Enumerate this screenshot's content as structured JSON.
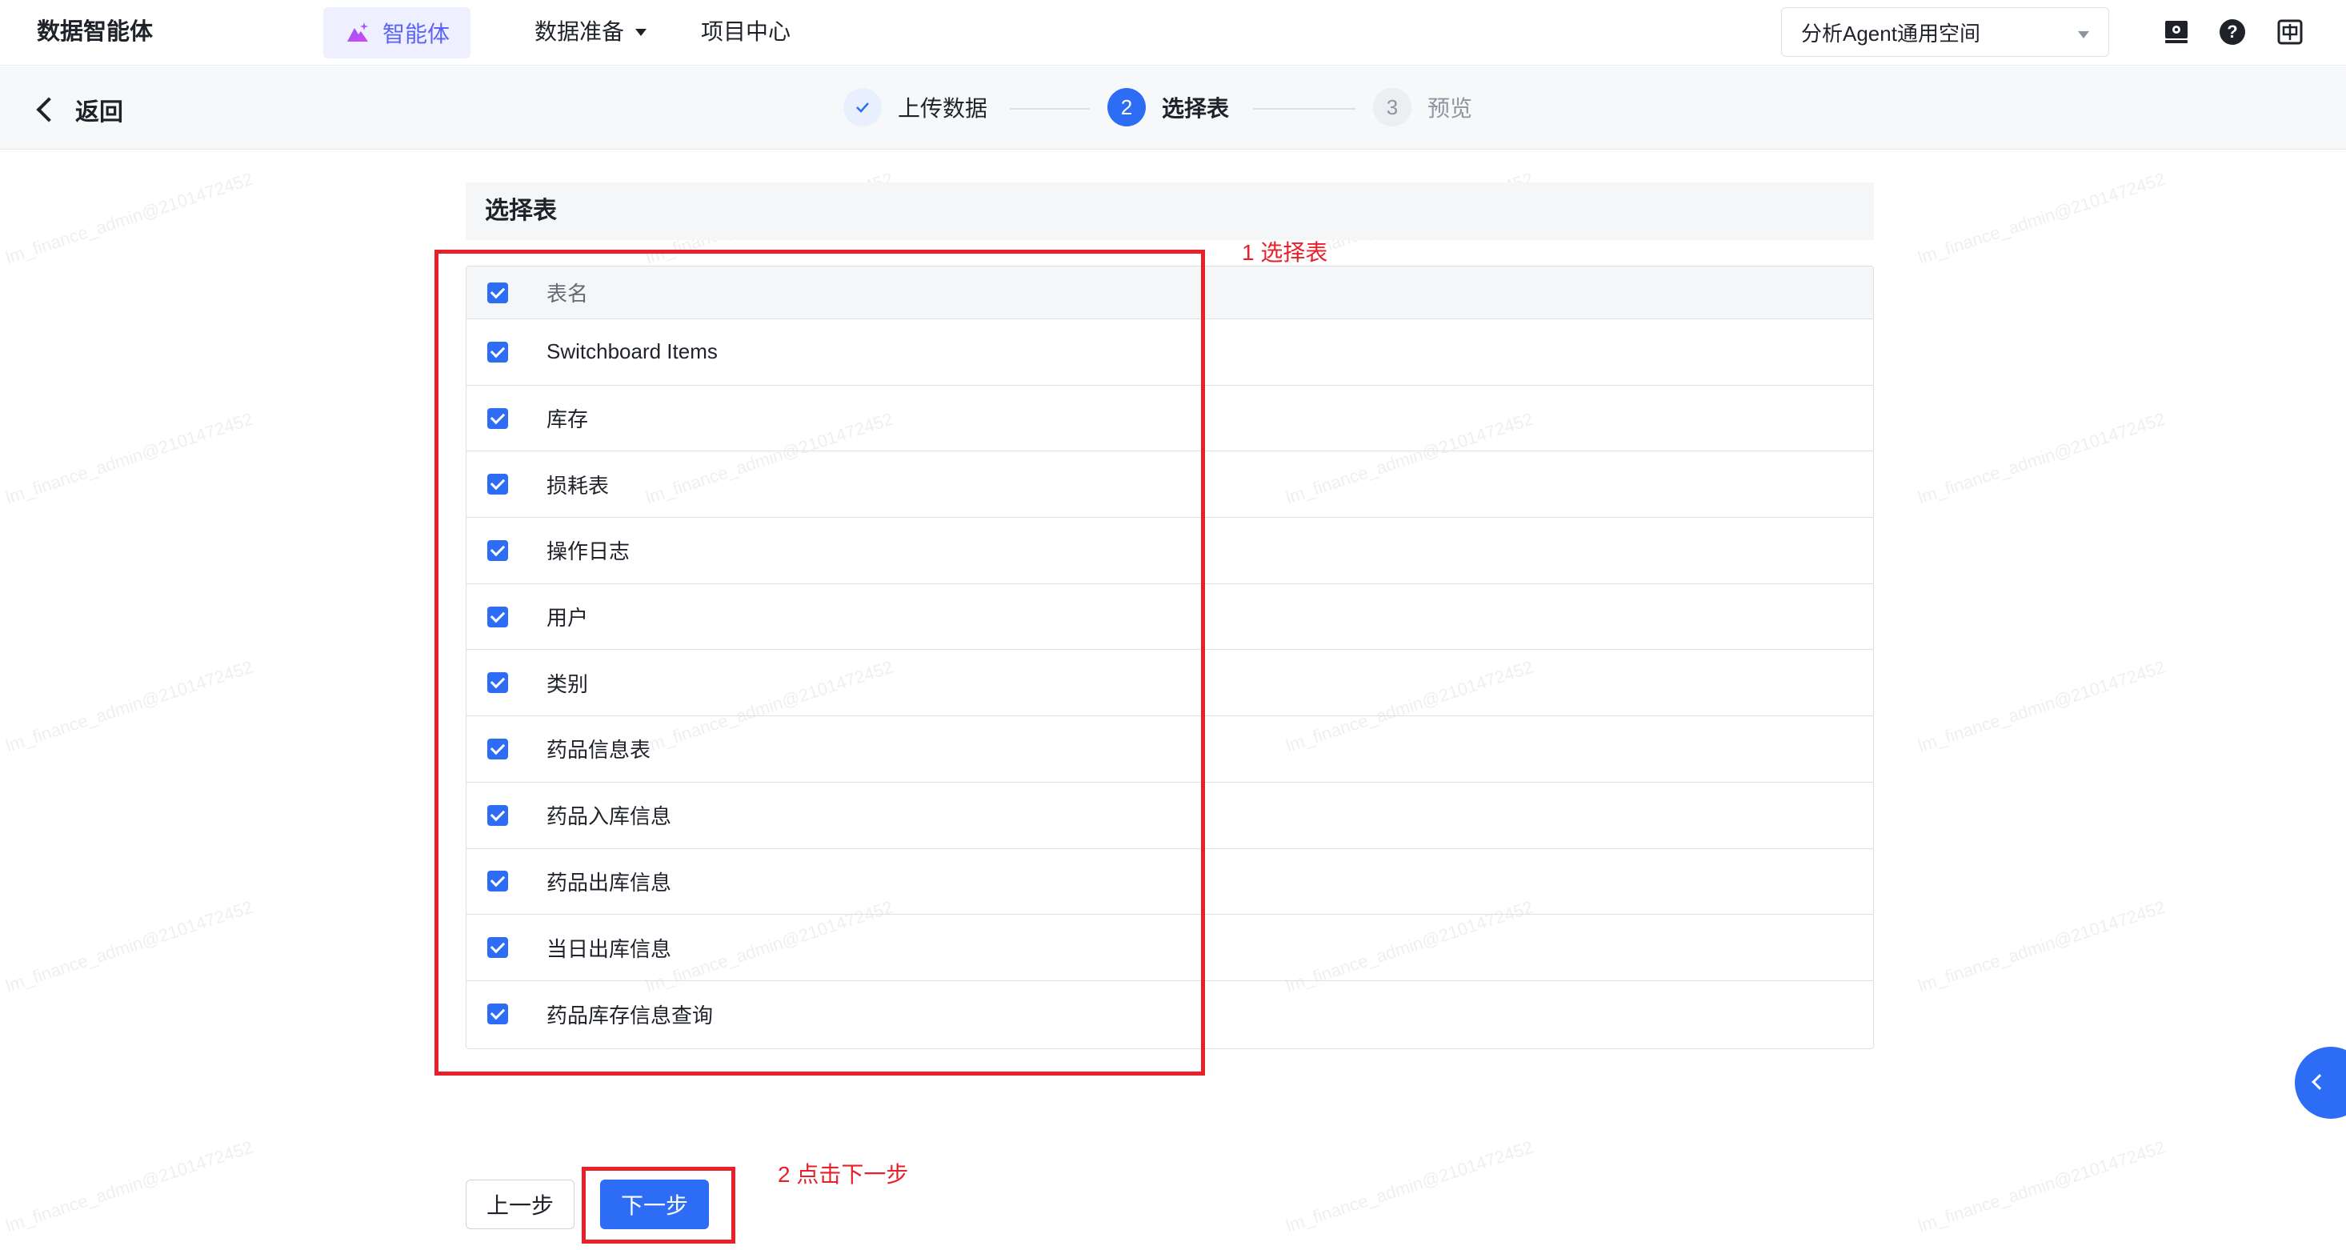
{
  "topbar": {
    "brand": "数据智能体",
    "nav_agent": "智能体",
    "nav_data": "数据准备",
    "nav_project": "项目中心",
    "workspace": "分析Agent通用空间"
  },
  "subbar": {
    "back": "返回",
    "steps": [
      {
        "index": "",
        "label": "上传数据",
        "status": "done"
      },
      {
        "index": "2",
        "label": "选择表",
        "status": "active"
      },
      {
        "index": "3",
        "label": "预览",
        "status": "pending"
      }
    ]
  },
  "section": {
    "title": "选择表",
    "header": "表名",
    "rows": [
      "Switchboard Items",
      "库存",
      "损耗表",
      "操作日志",
      "用户",
      "类别",
      "药品信息表",
      "药品入库信息",
      "药品出库信息",
      "当日出库信息",
      "药品库存信息查询"
    ]
  },
  "annotations": {
    "select_table": "1 选择表",
    "click_next": "2 点击下一步"
  },
  "buttons": {
    "prev": "上一步",
    "next": "下一步"
  },
  "watermark": "lm_finance_admin@2101472452",
  "colors": {
    "primary": "#2d6df6",
    "annotation": "#e8202a",
    "agent_purple": "#5b63f5"
  }
}
